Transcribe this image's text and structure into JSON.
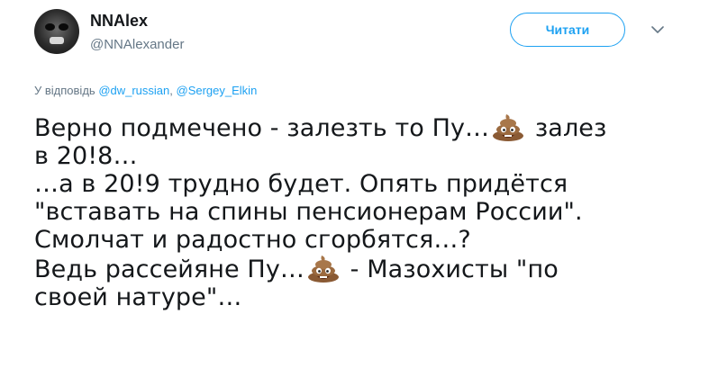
{
  "author": {
    "display_name": "NNAlex",
    "handle": "@NNAlexander",
    "avatar_icon": "avatar-face"
  },
  "actions": {
    "follow_label": "Читати",
    "menu_icon": "chevron-down-icon"
  },
  "reply": {
    "prefix": "У відповідь",
    "mention_1": "@dw_russian",
    "separator": ", ",
    "mention_2": "@Sergey_Elkin"
  },
  "tweet": {
    "line_1a": "Верно подмечено - залезть то Пу…",
    "line_1b": " залез",
    "line_2": "в 20!8…",
    "line_3": "…а в 20!9 трудно будет. Опять придётся",
    "line_4": "\"вставать на спины пенсионерам России\".",
    "line_5": "Смолчат и радостно сгорбятся…?",
    "line_6a": "Ведь рассейяне Пу…",
    "line_6b": " - Мазохисты \"по",
    "line_7": "своей натуре\"…",
    "emoji_icon": "pile-of-poo-icon"
  },
  "colors": {
    "accent": "#1da1f2",
    "secondary_text": "#657786",
    "primary_text": "#14171a"
  }
}
